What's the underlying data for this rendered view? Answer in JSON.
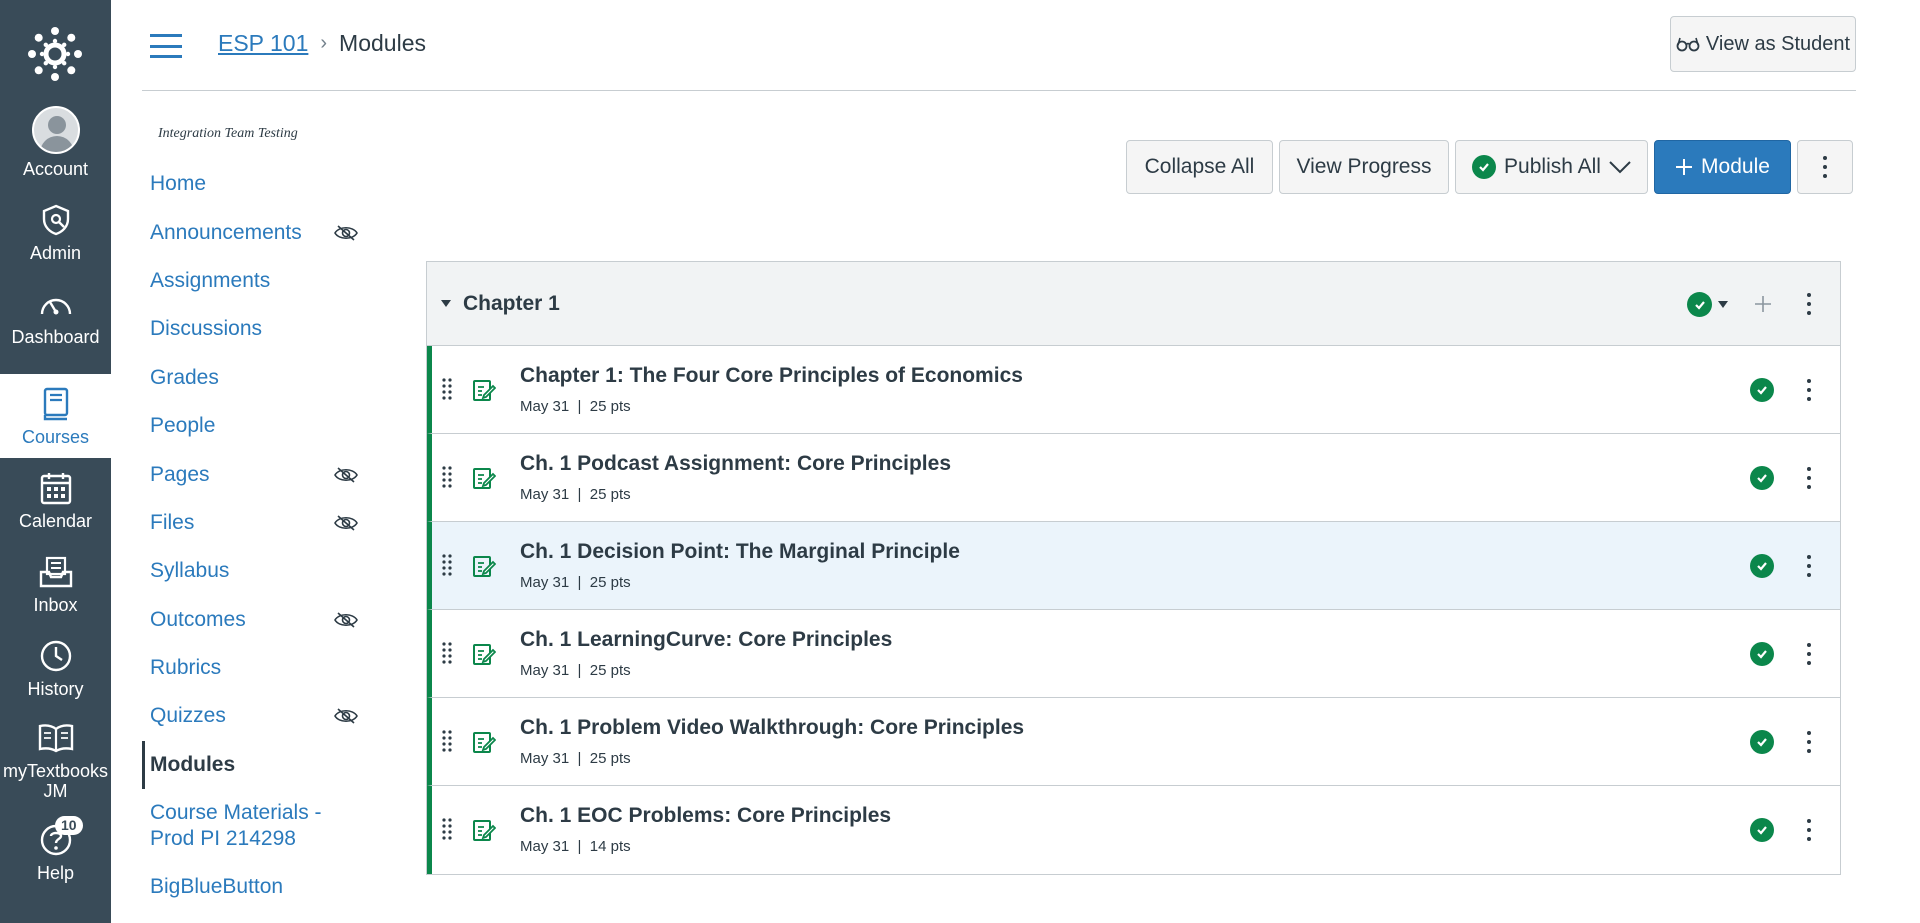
{
  "global_nav": {
    "logo_icon": "canvas-logo-icon",
    "items": [
      {
        "label": "Account",
        "icon": "avatar"
      },
      {
        "label": "Admin",
        "icon": "shield-icon"
      },
      {
        "label": "Dashboard",
        "icon": "gauge-icon"
      },
      {
        "label": "Courses",
        "icon": "book-icon",
        "active": true
      },
      {
        "label": "Calendar",
        "icon": "calendar-icon"
      },
      {
        "label": "Inbox",
        "icon": "inbox-icon"
      },
      {
        "label": "History",
        "icon": "clock-icon"
      },
      {
        "label": "myTextbooks JM",
        "icon": "open-book-icon"
      },
      {
        "label": "Help",
        "icon": "help-icon",
        "badge": "10"
      }
    ]
  },
  "header": {
    "breadcrumb_course": "ESP 101",
    "breadcrumb_sep": "›",
    "breadcrumb_current": "Modules",
    "view_as_student": "View as Student"
  },
  "course_nav": {
    "subtitle": "Integration Team Testing",
    "items": [
      {
        "label": "Home"
      },
      {
        "label": "Announcements",
        "hidden": true
      },
      {
        "label": "Assignments"
      },
      {
        "label": "Discussions"
      },
      {
        "label": "Grades"
      },
      {
        "label": "People"
      },
      {
        "label": "Pages",
        "hidden": true
      },
      {
        "label": "Files",
        "hidden": true
      },
      {
        "label": "Syllabus"
      },
      {
        "label": "Outcomes",
        "hidden": true
      },
      {
        "label": "Rubrics"
      },
      {
        "label": "Quizzes",
        "hidden": true
      },
      {
        "label": "Modules",
        "active": true
      },
      {
        "label": "Course Materials - Prod PI 214298"
      },
      {
        "label": "BigBlueButton"
      }
    ]
  },
  "toolbar": {
    "collapse_all": "Collapse All",
    "view_progress": "View Progress",
    "publish_all": "Publish All",
    "add_module": "Module"
  },
  "module": {
    "title": "Chapter 1",
    "items": [
      {
        "title": "Chapter 1: The Four Core Principles of Economics",
        "date": "May 31",
        "sep": "|",
        "points": "25 pts"
      },
      {
        "title": "Ch. 1 Podcast Assignment: Core Principles",
        "date": "May 31",
        "sep": "|",
        "points": "25 pts"
      },
      {
        "title": "Ch. 1 Decision Point: The Marginal Principle",
        "date": "May 31",
        "sep": "|",
        "points": "25 pts",
        "highlighted": true
      },
      {
        "title": "Ch. 1 LearningCurve: Core Principles",
        "date": "May 31",
        "sep": "|",
        "points": "25 pts"
      },
      {
        "title": "Ch. 1 Problem Video Walkthrough: Core Principles",
        "date": "May 31",
        "sep": "|",
        "points": "25 pts"
      },
      {
        "title": "Ch. 1 EOC Problems: Core Principles",
        "date": "May 31",
        "sep": "|",
        "points": "14 pts"
      }
    ]
  },
  "colors": {
    "nav_bg": "#394b58",
    "link": "#2b7abc",
    "published": "#0b874b",
    "highlight_row": "#ebf4fb"
  }
}
